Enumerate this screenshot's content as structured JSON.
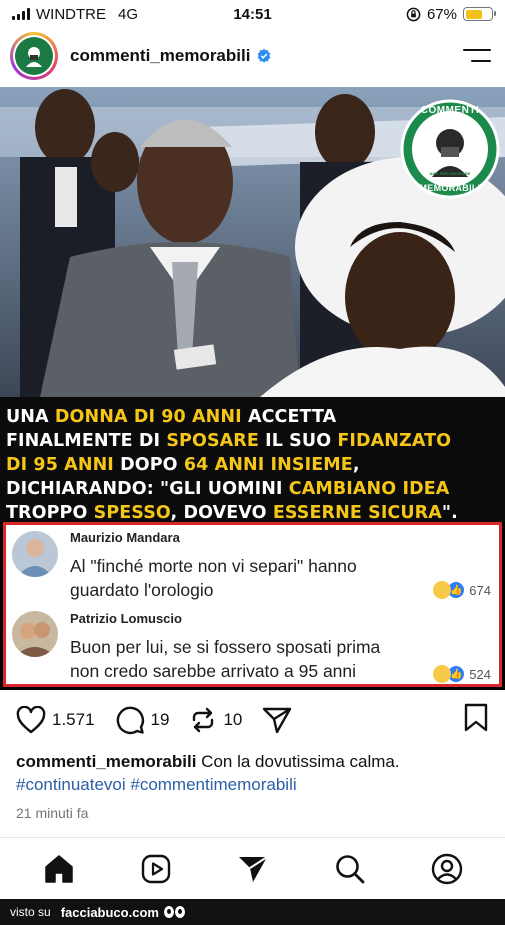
{
  "status_bar": {
    "carrier": "WINDTRE",
    "network": "4G",
    "time": "14:51",
    "battery": "67%",
    "battery_level": 0.67
  },
  "header": {
    "username": "commenti_memorabili"
  },
  "post": {
    "badge": {
      "line1": "COMMENTI",
      "line2": "MEMORABILI",
      "small": "NATI PER IGNORARE"
    },
    "headline": [
      [
        {
          "t": "UNA ",
          "h": false
        },
        {
          "t": "DONNA DI 90 ANNI",
          "h": true
        },
        {
          "t": " ACCETTA",
          "h": false
        }
      ],
      [
        {
          "t": "FINALMENTE DI ",
          "h": false
        },
        {
          "t": "SPOSARE",
          "h": true
        },
        {
          "t": " IL SUO ",
          "h": false
        },
        {
          "t": "FIDANZATO",
          "h": true
        }
      ],
      [
        {
          "t": "DI 95 ANNI",
          "h": true
        },
        {
          "t": " DOPO ",
          "h": false
        },
        {
          "t": "64 ANNI INSIEME",
          "h": true
        },
        {
          "t": ",",
          "h": false
        }
      ],
      [
        {
          "t": "DICHIARANDO: \"GLI UOMINI ",
          "h": false
        },
        {
          "t": "CAMBIANO IDEA",
          "h": true
        }
      ],
      [
        {
          "t": "TROPPO ",
          "h": false
        },
        {
          "t": "SPESSO",
          "h": true
        },
        {
          "t": ", DOVEVO ",
          "h": false
        },
        {
          "t": "ESSERNE SICURA",
          "h": true
        },
        {
          "t": "\".",
          "h": false
        }
      ]
    ],
    "comments": [
      {
        "name": "Maurizio Mandara",
        "line1": "Al \"finché morte non vi separi\" hanno",
        "line2": "guardato l'orologio",
        "reactions": "674"
      },
      {
        "name": "Patrizio Lomuscio",
        "line1": "Buon per lui, se si fossero sposati prima",
        "line2": "non credo sarebbe arrivato a 95 anni",
        "reactions": "524"
      }
    ]
  },
  "actions": {
    "likes": "1.571",
    "comments": "19",
    "reposts": "10"
  },
  "caption": {
    "username": "commenti_memorabili",
    "text": " Con la dovutissima calma.",
    "hashtags": "#continuatevoi #commentimemorabili",
    "time_ago": "21 minuti fa"
  },
  "watermark": {
    "prefix": "visto su",
    "site": "facciabuco.com"
  },
  "colors": {
    "highlight": "#f5c518",
    "border": "#d9262b",
    "link": "#2b5fa8"
  }
}
